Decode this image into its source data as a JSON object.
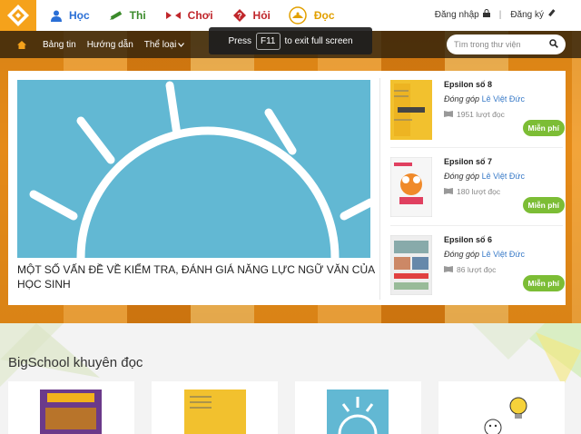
{
  "topnav": {
    "items": [
      {
        "label": "Học",
        "color": "#2a6fd6",
        "icon": "student-icon"
      },
      {
        "label": "Thi",
        "color": "#3a8a2a",
        "icon": "pencil-icon"
      },
      {
        "label": "Chơi",
        "color": "#c0262b",
        "icon": "game-icon"
      },
      {
        "label": "Hỏi",
        "color": "#c0262b",
        "icon": "question-icon"
      },
      {
        "label": "Đọc",
        "color": "#e2a000",
        "icon": "book-read-icon"
      }
    ],
    "login": "Đăng nhập",
    "register": "Đăng ký",
    "separator": "|"
  },
  "subnav": {
    "news": "Bảng tin",
    "guide": "Hướng dẫn",
    "category": "Thể loại"
  },
  "search": {
    "placeholder": "Tìm trong thư viện"
  },
  "fullscreen_toast": {
    "press": "Press",
    "key": "F11",
    "text": "to exit full screen"
  },
  "featured": {
    "title": "MỘT SỐ VẤN ĐỀ VỀ KIỂM TRA, ĐÁNH GIÁ NĂNG LỰC NGỮ VĂN CỦA HỌC SINH"
  },
  "books": [
    {
      "title": "Epsilon số 8",
      "contrib_label": "Đóng góp",
      "author": "Lê Việt Đức",
      "reads": "1951 lượt đọc",
      "badge": "Miễn phí"
    },
    {
      "title": "Epsilon số 7",
      "contrib_label": "Đóng góp",
      "author": "Lê Việt Đức",
      "reads": "180 lượt đọc",
      "badge": "Miễn phí"
    },
    {
      "title": "Epsilon số 6",
      "contrib_label": "Đóng góp",
      "author": "Lê Việt Đức",
      "reads": "86 lượt đọc",
      "badge": "Miễn phí"
    }
  ],
  "recommend": {
    "title": "BigSchool khuyên đọc"
  },
  "colors": {
    "brand": "#f5a21b",
    "free": "#7cbd35",
    "link": "#3a7bc8"
  }
}
